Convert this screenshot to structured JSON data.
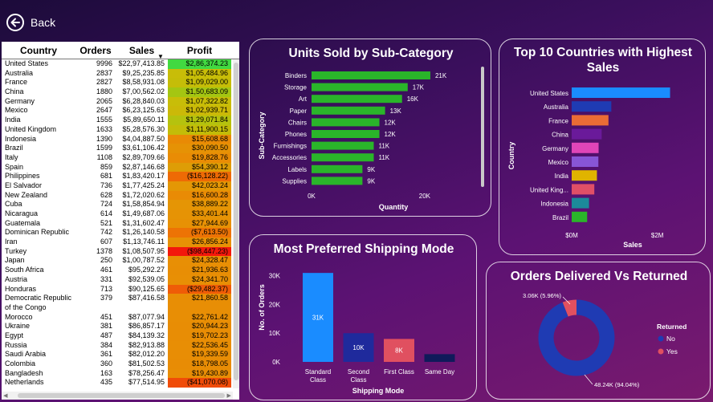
{
  "nav": {
    "back_label": "Back"
  },
  "table": {
    "headers": [
      "Country",
      "Orders",
      "Sales",
      "Profit"
    ],
    "rows": [
      {
        "country": "United States",
        "orders": "9996",
        "sales": "$22,97,413.85",
        "profit": "$2,86,374.23",
        "color": "#41d941"
      },
      {
        "country": "Australia",
        "orders": "2837",
        "sales": "$9,25,235.85",
        "profit": "$1,05,484.96",
        "color": "#c8bd08"
      },
      {
        "country": "France",
        "orders": "2827",
        "sales": "$8,58,931.08",
        "profit": "$1,09,029.00",
        "color": "#c5bd08"
      },
      {
        "country": "China",
        "orders": "1880",
        "sales": "$7,00,562.02",
        "profit": "$1,50,683.09",
        "color": "#a4c612"
      },
      {
        "country": "Germany",
        "orders": "2065",
        "sales": "$6,28,840.03",
        "profit": "$1,07,322.82",
        "color": "#c8bd08"
      },
      {
        "country": "Mexico",
        "orders": "2647",
        "sales": "$6,23,125.63",
        "profit": "$1,02,939.71",
        "color": "#cbb908"
      },
      {
        "country": "India",
        "orders": "1555",
        "sales": "$5,89,650.11",
        "profit": "$1,29,071.84",
        "color": "#b5c20e"
      },
      {
        "country": "United Kingdom",
        "orders": "1633",
        "sales": "$5,28,576.30",
        "profit": "$1,11,900.15",
        "color": "#c3bc08"
      },
      {
        "country": "Indonesia",
        "orders": "1390",
        "sales": "$4,04,887.50",
        "profit": "$15,608.68",
        "color": "#e98a05"
      },
      {
        "country": "Brazil",
        "orders": "1599",
        "sales": "$3,61,106.42",
        "profit": "$30,090.50",
        "color": "#e69205"
      },
      {
        "country": "Italy",
        "orders": "1108",
        "sales": "$2,89,709.66",
        "profit": "$19,828.76",
        "color": "#e98c05"
      },
      {
        "country": "Spain",
        "orders": "859",
        "sales": "$2,87,146.68",
        "profit": "$54,390.12",
        "color": "#de9d06"
      },
      {
        "country": "Philippines",
        "orders": "681",
        "sales": "$1,83,420.17",
        "profit": "($16,128.22)",
        "color": "#ee6a05"
      },
      {
        "country": "El Salvador",
        "orders": "736",
        "sales": "$1,77,425.24",
        "profit": "$42,023.24",
        "color": "#e49705"
      },
      {
        "country": "New Zealand",
        "orders": "628",
        "sales": "$1,72,020.62",
        "profit": "$16,600.28",
        "color": "#e98b05"
      },
      {
        "country": "Cuba",
        "orders": "724",
        "sales": "$1,58,854.94",
        "profit": "$38,889.22",
        "color": "#e59505"
      },
      {
        "country": "Nicaragua",
        "orders": "614",
        "sales": "$1,49,687.06",
        "profit": "$33,401.44",
        "color": "#e69305"
      },
      {
        "country": "Guatemala",
        "orders": "521",
        "sales": "$1,31,602.47",
        "profit": "$27,944.69",
        "color": "#e79105"
      },
      {
        "country": "Dominican Republic",
        "orders": "742",
        "sales": "$1,26,140.58",
        "profit": "($7,613.50)",
        "color": "#ed7305"
      },
      {
        "country": "Iran",
        "orders": "607",
        "sales": "$1,13,746.11",
        "profit": "$26,856.24",
        "color": "#e79105"
      },
      {
        "country": "Turkey",
        "orders": "1378",
        "sales": "$1,08,507.95",
        "profit": "($98,447.23)",
        "color": "#f3180c"
      },
      {
        "country": "Japan",
        "orders": "250",
        "sales": "$1,00,787.52",
        "profit": "$24,328.47",
        "color": "#e88f05"
      },
      {
        "country": "South Africa",
        "orders": "461",
        "sales": "$95,292.27",
        "profit": "$21,936.63",
        "color": "#e88e05"
      },
      {
        "country": "Austria",
        "orders": "331",
        "sales": "$92,539.05",
        "profit": "$24,341.70",
        "color": "#e88f05"
      },
      {
        "country": "Honduras",
        "orders": "713",
        "sales": "$90,125.65",
        "profit": "($29,482.37)",
        "color": "#ef5c07"
      },
      {
        "country": "Democratic Republic of the Congo",
        "orders": "379",
        "sales": "$87,416.58",
        "profit": "$21,860.58",
        "color": "#e88e05",
        "tall": true
      },
      {
        "country": "Morocco",
        "orders": "451",
        "sales": "$87,077.94",
        "profit": "$22,761.42",
        "color": "#e88e05"
      },
      {
        "country": "Ukraine",
        "orders": "381",
        "sales": "$86,857.17",
        "profit": "$20,944.23",
        "color": "#e88d05"
      },
      {
        "country": "Egypt",
        "orders": "487",
        "sales": "$84,139.32",
        "profit": "$19,702.23",
        "color": "#e88d05"
      },
      {
        "country": "Russia",
        "orders": "384",
        "sales": "$82,913.88",
        "profit": "$22,536.45",
        "color": "#e88e05"
      },
      {
        "country": "Saudi Arabia",
        "orders": "361",
        "sales": "$82,012.20",
        "profit": "$19,339.59",
        "color": "#e88d05"
      },
      {
        "country": "Colombia",
        "orders": "360",
        "sales": "$81,502.53",
        "profit": "$18,798.05",
        "color": "#e88c05"
      },
      {
        "country": "Bangladesh",
        "orders": "163",
        "sales": "$78,256.47",
        "profit": "$19,430.89",
        "color": "#e88d05"
      },
      {
        "country": "Netherlands",
        "orders": "435",
        "sales": "$77,514.95",
        "profit": "($41,070.08)",
        "color": "#f04c08"
      }
    ]
  },
  "chart_data": [
    {
      "type": "bar",
      "orientation": "horizontal",
      "title": "Units Sold by Sub-Category",
      "xlabel": "Quantity",
      "ylabel": "Sub-Category",
      "categories": [
        "Binders",
        "Storage",
        "Art",
        "Paper",
        "Chairs",
        "Phones",
        "Furnishings",
        "Accessories",
        "Labels",
        "Supplies"
      ],
      "values": [
        21000,
        17000,
        16000,
        13000,
        12000,
        12000,
        11000,
        11000,
        9000,
        9000
      ],
      "data_labels": [
        "21K",
        "17K",
        "16K",
        "13K",
        "12K",
        "12K",
        "11K",
        "11K",
        "9K",
        "9K"
      ],
      "xticks": [
        "0K",
        "20K"
      ],
      "xlim": [
        0,
        22000
      ],
      "color": "#2ab52a"
    },
    {
      "type": "bar",
      "orientation": "horizontal",
      "title": "Top 10 Countries with Highest Sales",
      "xlabel": "Sales",
      "ylabel": "Country",
      "categories": [
        "United States",
        "Australia",
        "France",
        "China",
        "Germany",
        "Mexico",
        "India",
        "United King...",
        "Indonesia",
        "Brazil"
      ],
      "values": [
        2297413.85,
        925235.85,
        858931.08,
        700562.02,
        628840.03,
        623125.63,
        589650.11,
        528576.3,
        404887.5,
        361106.42
      ],
      "colors": [
        "#1a8cff",
        "#1f3bb3",
        "#ea6c35",
        "#6a1a9a",
        "#e045b8",
        "#8855d6",
        "#e0b400",
        "#e04f67",
        "#1c8a9a",
        "#2ab52a"
      ],
      "xticks": [
        "$0M",
        "$2M"
      ],
      "xlim": [
        0,
        2400000
      ]
    },
    {
      "type": "bar",
      "title": "Most Preferred Shipping Mode",
      "xlabel": "Shipping Mode",
      "ylabel": "No. of Orders",
      "categories": [
        "Standard Class",
        "Second Class",
        "First Class",
        "Same Day"
      ],
      "values": [
        31000,
        10000,
        8000,
        2700
      ],
      "data_labels": [
        "31K",
        "10K",
        "8K",
        ""
      ],
      "colors": [
        "#1a8cff",
        "#1f2a9c",
        "#e05060",
        "#101a5a"
      ],
      "yticks": [
        "0K",
        "10K",
        "20K",
        "30K"
      ],
      "ylim": [
        0,
        33000
      ]
    },
    {
      "type": "pie",
      "style": "donut",
      "title": "Orders Delivered Vs Returned",
      "legend_title": "Returned",
      "labels": [
        "No",
        "Yes"
      ],
      "values": [
        48240,
        3060
      ],
      "data_labels": [
        "48.24K (94.04%)",
        "3.06K (5.96%)"
      ],
      "colors": [
        "#1f3bb3",
        "#e05060"
      ],
      "legend_position": "right"
    }
  ]
}
